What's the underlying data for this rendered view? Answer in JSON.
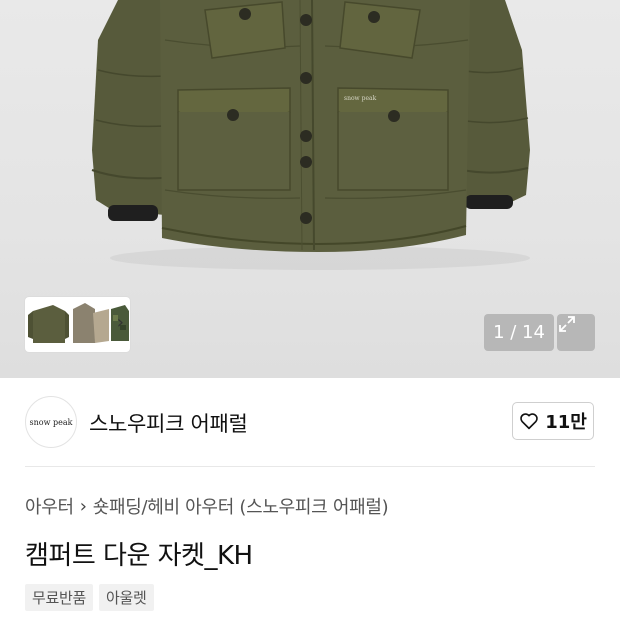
{
  "gallery": {
    "counter": "1 / 14",
    "main_image": "khaki-down-jacket-photo",
    "thumbnails": [
      "khaki-jacket",
      "beige-jacket",
      "camo-jacket"
    ],
    "jacket_logo_text": "snow peak"
  },
  "brand": {
    "name": "스노우피크 어패럴",
    "logo_text": "snow peak",
    "like_count": "11만"
  },
  "breadcrumb": {
    "level1": "아우터",
    "level2": "숏패딩/헤비 아우터 (스노우피크 어패럴)"
  },
  "product": {
    "title": "캠퍼트 다운 자켓_KH"
  },
  "tags": [
    "무료반품",
    "아울렛"
  ],
  "colors": {
    "jacket_khaki": "#5a5a3c",
    "counter_bg": "#9a9a9a"
  }
}
